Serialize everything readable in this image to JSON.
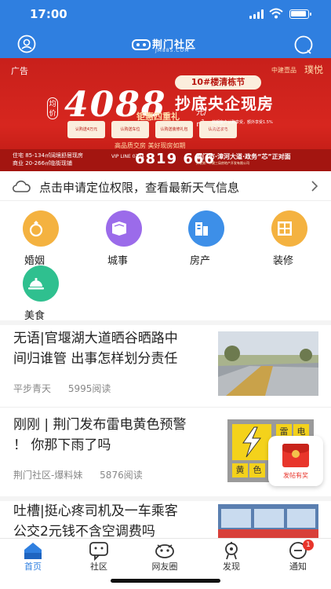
{
  "status_bar": {
    "time": "17:00"
  },
  "header": {
    "logo_text": "荆门社区",
    "logo_sub": "JM885.COM"
  },
  "banner": {
    "top_left": "广告",
    "top_right": "中建壹品",
    "seal": "璞悦",
    "price_tag": "均价",
    "price": "4088",
    "unit": "元/㎡",
    "pill": "10#楼清栋节",
    "headline": "抄底央企现房",
    "gift": "钜惠四重礼",
    "chips": [
      "认购送4万元",
      "认购送车位",
      "认购送装修礼包",
      "认购送家电"
    ],
    "chip_right": "前期客户认购享受，额外享受1.5%购房折扣",
    "slogan": "高品质交房  美好现房如期",
    "spec_1": "住宅 85-134㎡阔境舒居现房",
    "spec_2": "商业 20-266㎡临街现铺",
    "vip": "VIP LINE 0724",
    "phone": "6819 666",
    "address": "荆门市·漳河大道·政务“芯”正对面",
    "fine": "开发商：中建三局房地产开发有限公司"
  },
  "weather": {
    "text": "点击申请定位权限，查看最新天气信息"
  },
  "categories": [
    {
      "label": "婚姻",
      "color": "#f4b240",
      "icon": "ring-icon"
    },
    {
      "label": "城事",
      "color": "#9b6bea",
      "icon": "book-icon"
    },
    {
      "label": "房产",
      "color": "#3d8fe8",
      "icon": "building-icon"
    },
    {
      "label": "装修",
      "color": "#f4b240",
      "icon": "window-icon"
    },
    {
      "label": "美食",
      "color": "#2fc08f",
      "icon": "dish-icon"
    }
  ],
  "articles": [
    {
      "title_1": "无语|官堰湖大道晒谷晒路中",
      "title_2": "间归谁管 出事怎样划分责任",
      "author": "平步青天",
      "reads": "5995阅读"
    },
    {
      "title_1": "刚刚 | 荆门发布雷电黄色预警",
      "title_2": "！ 你那下雨了吗",
      "author": "荆门社区-爆料妹",
      "reads": "5876阅读"
    },
    {
      "title_1": "吐槽|挺心疼司机及一车乘客",
      "title_2": "公交2元钱不含空调费吗",
      "author": "",
      "reads": ""
    }
  ],
  "warning_thumb": {
    "chars": [
      "雷",
      "电",
      "黄",
      "色"
    ]
  },
  "red_envelope": {
    "label": "发帖有奖"
  },
  "tabs": [
    {
      "label": "首页",
      "icon": "home-icon"
    },
    {
      "label": "社区",
      "icon": "community-icon"
    },
    {
      "label": "网友圈",
      "icon": "circle-icon"
    },
    {
      "label": "发现",
      "icon": "discover-icon"
    },
    {
      "label": "通知",
      "icon": "notification-icon"
    }
  ],
  "notification_badge": "1",
  "colors": {
    "brand_blue": "#2f7fe0",
    "banner_red": "#d7261f",
    "badge_red": "#e8352b"
  }
}
